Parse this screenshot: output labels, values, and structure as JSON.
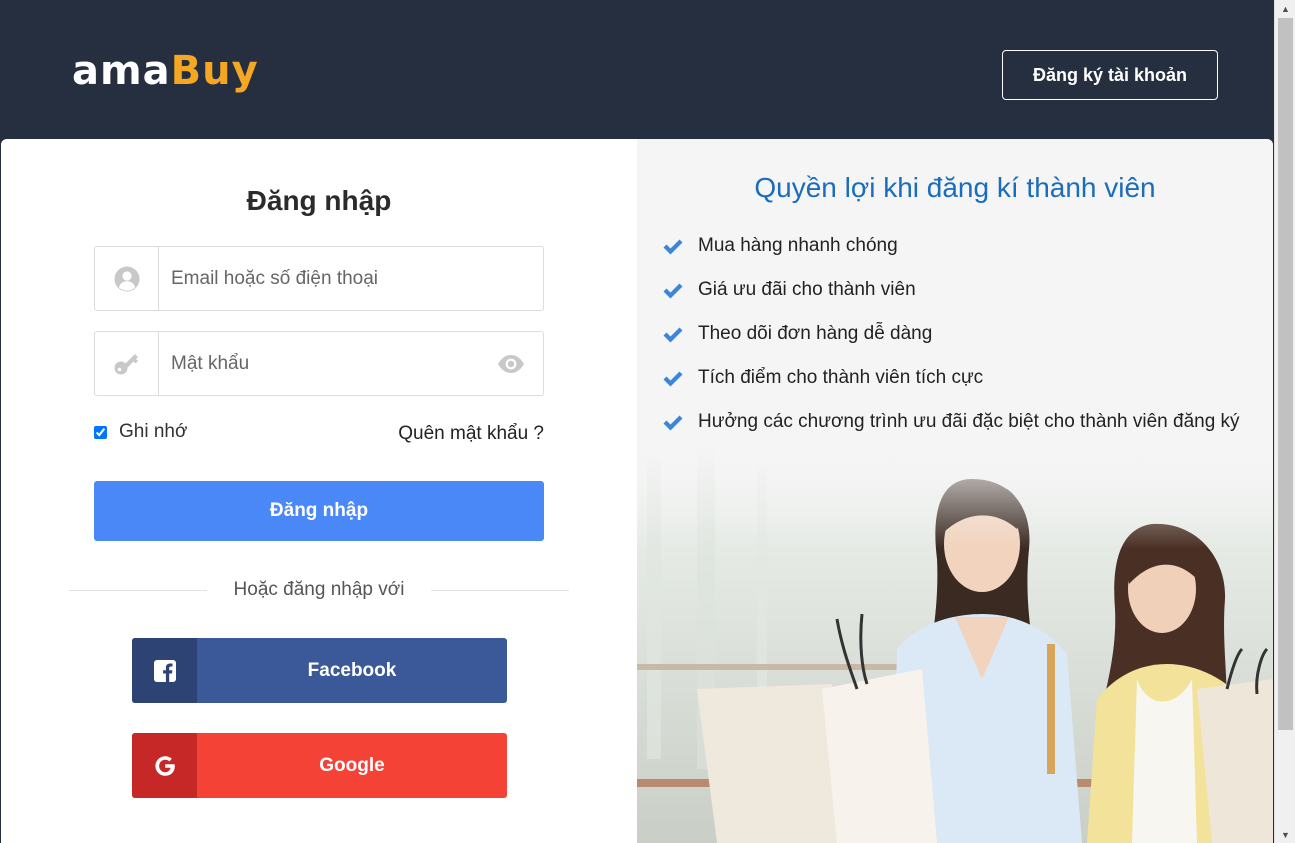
{
  "header": {
    "logo_part1": "ama",
    "logo_part2": "Buy",
    "register_label": "Đăng ký tài khoản"
  },
  "login": {
    "title": "Đăng nhập",
    "email_placeholder": "Email hoặc số điện thoại",
    "password_placeholder": "Mật khẩu",
    "remember_label": "Ghi nhớ",
    "remember_checked": true,
    "forgot_label": "Quên mật khẩu ?",
    "submit_label": "Đăng nhập",
    "divider_text": "Hoặc đăng nhập với",
    "facebook_label": "Facebook",
    "google_label": "Google"
  },
  "benefits": {
    "title": "Quyền lợi khi đăng kí thành viên",
    "items": [
      "Mua hàng nhanh chóng",
      "Giá ưu đãi cho thành viên",
      "Theo dõi đơn hàng dễ dàng",
      "Tích điểm cho thành viên tích cực",
      "Hưởng các chương trình ưu đãi đặc biệt cho thành viên đăng ký"
    ]
  },
  "colors": {
    "header_bg": "#252f3f",
    "logo_accent": "#f5a623",
    "primary": "#4a88f7",
    "facebook": "#3b5998",
    "google": "#f44336",
    "benefit_title": "#1a6cbd",
    "check": "#3a86d8"
  },
  "icons": {
    "user": "user-circle-icon",
    "key": "key-icon",
    "eye": "eye-icon",
    "facebook": "facebook-icon",
    "google": "google-icon",
    "check": "check-icon"
  }
}
